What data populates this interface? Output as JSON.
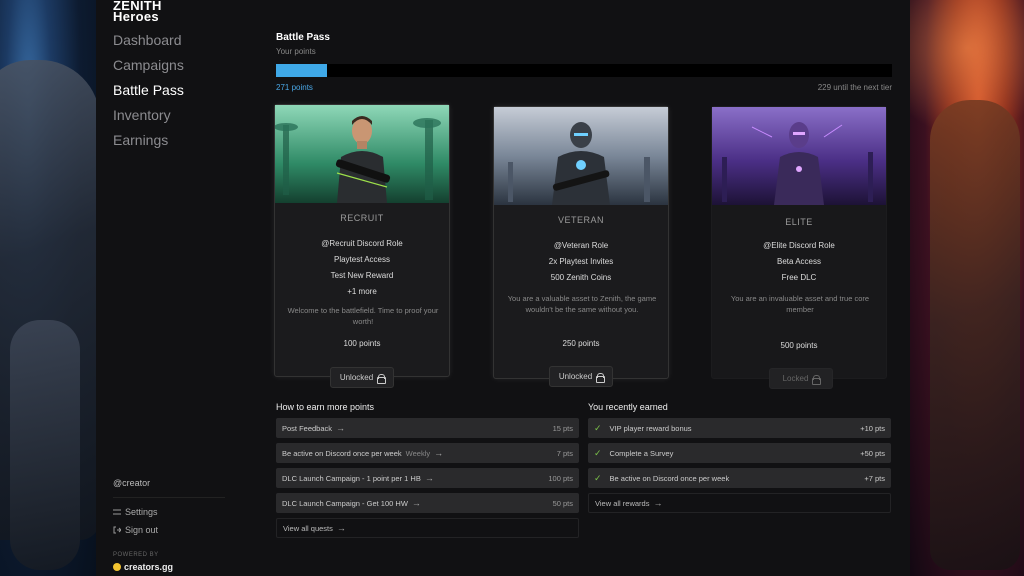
{
  "app": {
    "logo_line1": "ZENITH",
    "logo_line2": "Heroes"
  },
  "sidebar": {
    "items": [
      {
        "label": "Dashboard",
        "active": false
      },
      {
        "label": "Campaigns",
        "active": false
      },
      {
        "label": "Battle Pass",
        "active": true
      },
      {
        "label": "Inventory",
        "active": false
      },
      {
        "label": "Earnings",
        "active": false
      }
    ],
    "user": "@creator",
    "settings": "Settings",
    "signout": "Sign out",
    "powered_by": "POWERED BY",
    "brand": "creators.gg"
  },
  "battle_pass": {
    "title": "Battle Pass",
    "subtitle": "Your points",
    "progress": 0.082,
    "points_now": "271 points",
    "points_next": "229 until the next tier"
  },
  "tiers": [
    {
      "name": "RECRUIT",
      "perks": [
        "@Recruit Discord Role",
        "Playtest Access",
        "Test New Reward",
        "+1 more"
      ],
      "desc": "Welcome to the battlefield. Time to proof your worth!",
      "points": "100 points",
      "status": "Unlocked"
    },
    {
      "name": "VETERAN",
      "perks": [
        "@Veteran Role",
        "2x Playtest Invites",
        "500 Zenith Coins"
      ],
      "desc": "You are a valuable asset to Zenith, the game wouldn't be the same without you.",
      "points": "250 points",
      "status": "Unlocked"
    },
    {
      "name": "ELITE",
      "perks": [
        "@Elite Discord Role",
        "Beta Access",
        "Free DLC"
      ],
      "desc": "You are an invaluable asset and true core member",
      "points": "500 points",
      "status": "Locked"
    }
  ],
  "earn": {
    "title": "How to earn more points",
    "quests": [
      {
        "label": "Post Feedback",
        "tag": "",
        "pts": "15 pts"
      },
      {
        "label": "Be active on Discord once per week",
        "tag": "Weekly",
        "pts": "7 pts"
      },
      {
        "label": "DLC Launch Campaign - 1 point per 1 HB",
        "tag": "",
        "pts": "100 pts"
      },
      {
        "label": "DLC Launch Campaign - Get 100 HW",
        "tag": "",
        "pts": "50 pts"
      }
    ],
    "view_all": "View all quests"
  },
  "recent": {
    "title": "You recently earned",
    "items": [
      {
        "label": "VIP player reward bonus",
        "pts": "+10 pts"
      },
      {
        "label": "Complete a Survey",
        "pts": "+50 pts"
      },
      {
        "label": "Be active on Discord once per week",
        "pts": "+7 pts"
      }
    ],
    "view_all": "View all rewards"
  },
  "colors": {
    "accent": "#3fa9e8",
    "check": "#7cc24a"
  }
}
